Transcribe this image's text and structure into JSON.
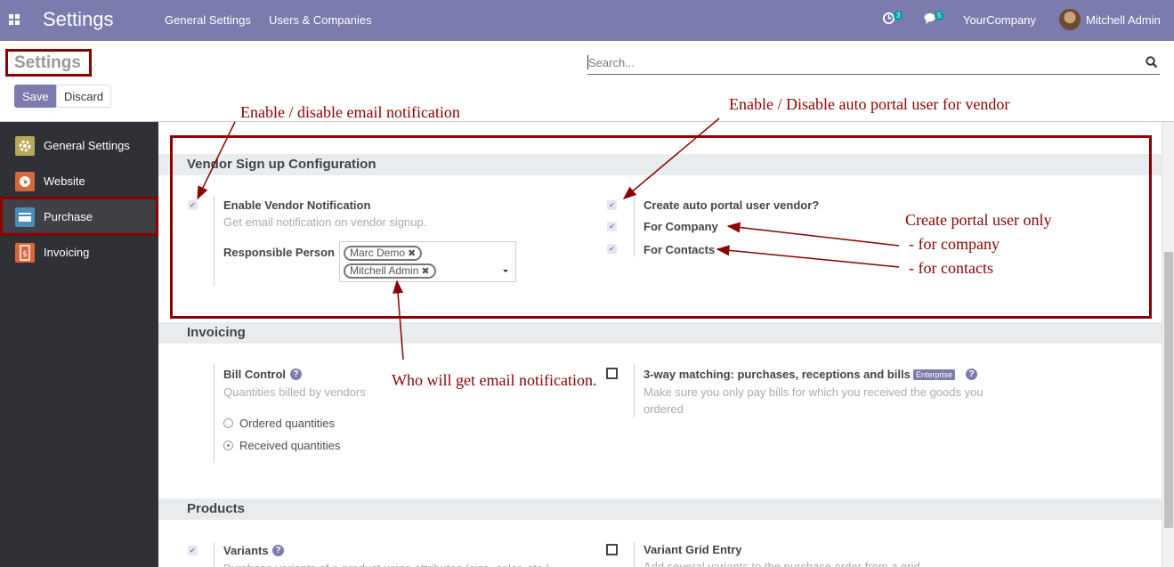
{
  "topbar": {
    "app_title": "Settings",
    "menu": [
      "General Settings",
      "Users & Companies"
    ],
    "activity_count": "3",
    "message_count": "5",
    "company": "YourCompany",
    "user": "Mitchell Admin"
  },
  "control_panel": {
    "title": "Settings",
    "save_label": "Save",
    "discard_label": "Discard",
    "search_placeholder": "Search..."
  },
  "sidebar": {
    "items": [
      {
        "label": "General Settings",
        "icon": "gear-icon",
        "color": "#b8a85a"
      },
      {
        "label": "Website",
        "icon": "globe-icon",
        "color": "#d9673a"
      },
      {
        "label": "Purchase",
        "icon": "purchase-card-icon",
        "color": "#4a8db8",
        "active": true
      },
      {
        "label": "Invoicing",
        "icon": "invoice-icon",
        "color": "#d9673a"
      }
    ]
  },
  "vendor_signup": {
    "heading": "Vendor Sign up Configuration",
    "enable_notification": {
      "title": "Enable Vendor Notification",
      "help": "Get email notification on vendor signup.",
      "checked": true
    },
    "responsible_label": "Responsible Person",
    "responsible_tags": [
      "Marc Demo",
      "Mitchell Admin"
    ],
    "auto_portal": {
      "title": "Create auto portal user vendor?",
      "checked": true
    },
    "for_company": {
      "title": "For Company",
      "checked": true
    },
    "for_contacts": {
      "title": "For Contacts",
      "checked": true
    }
  },
  "invoicing": {
    "heading": "Invoicing",
    "bill_control": {
      "title": "Bill Control",
      "help": "Quantities billed by vendors"
    },
    "radio_options": [
      {
        "label": "Ordered quantities",
        "selected": false
      },
      {
        "label": "Received quantities",
        "selected": true
      }
    ],
    "three_way": {
      "title": "3-way matching: purchases, receptions and bills",
      "badge": "Enterprise",
      "help_line1": "Make sure you only pay bills for which you received the goods you",
      "help_line2": "ordered",
      "checked": false
    }
  },
  "products": {
    "heading": "Products",
    "variants": {
      "title": "Variants",
      "help": "Purchase variants of a product using attributes (size, color, etc.)",
      "checked": true
    },
    "variant_grid": {
      "title": "Variant Grid Entry",
      "help": "Add several variants to the purchase order from a grid",
      "checked": false
    }
  },
  "annotations": {
    "email_notification": "Enable / disable email notification",
    "auto_portal": "Enable / Disable auto portal user for vendor",
    "portal_only_line1": "Create portal user only",
    "portal_only_line2": "- for company",
    "portal_only_line3": "- for contacts",
    "who_gets_email": "Who will get email notification."
  },
  "colors": {
    "primary": "#7c7bad",
    "annotation": "#8b0000",
    "sidebar": "#2f3136"
  }
}
